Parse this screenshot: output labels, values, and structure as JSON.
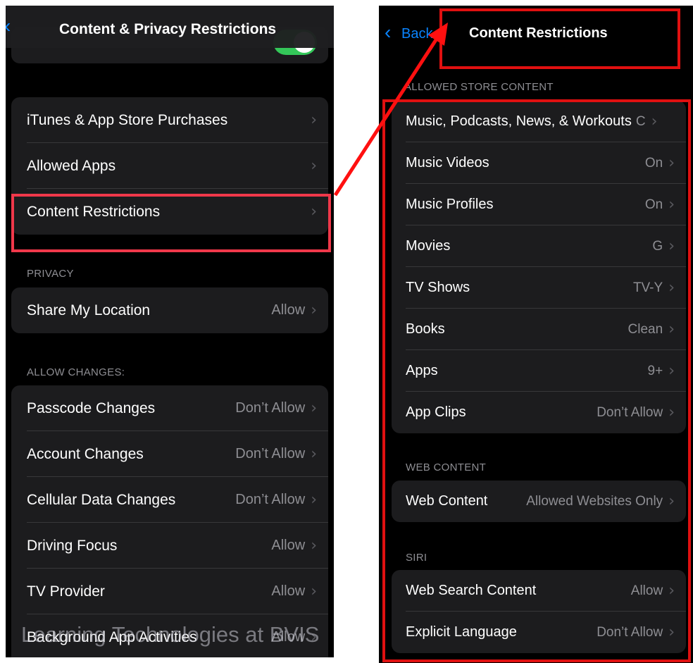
{
  "left_screen": {
    "title": "Content & Privacy Restrictions",
    "main_group": [
      {
        "label": "iTunes & App Store Purchases",
        "value": ""
      },
      {
        "label": "Allowed Apps",
        "value": ""
      },
      {
        "label": "Content Restrictions",
        "value": ""
      }
    ],
    "privacy_header": "PRIVACY",
    "privacy_group": [
      {
        "label": "Share My Location",
        "value": "Allow"
      }
    ],
    "allow_changes_header": "ALLOW CHANGES:",
    "changes_group": [
      {
        "label": "Passcode Changes",
        "value": "Don’t Allow"
      },
      {
        "label": "Account Changes",
        "value": "Don’t Allow"
      },
      {
        "label": "Cellular Data Changes",
        "value": "Don’t Allow"
      },
      {
        "label": "Driving Focus",
        "value": "Allow"
      },
      {
        "label": "TV Provider",
        "value": "Allow"
      },
      {
        "label": "Background App Activities",
        "value": "Allow"
      }
    ]
  },
  "right_screen": {
    "back_label": "Back",
    "title": "Content Restrictions",
    "store_header": "ALLOWED STORE CONTENT",
    "store_group": [
      {
        "label": "Music, Podcasts, News, & Workouts",
        "value": "C"
      },
      {
        "label": "Music Videos",
        "value": "On"
      },
      {
        "label": "Music Profiles",
        "value": "On"
      },
      {
        "label": "Movies",
        "value": "G"
      },
      {
        "label": "TV Shows",
        "value": "TV-Y"
      },
      {
        "label": "Books",
        "value": "Clean"
      },
      {
        "label": "Apps",
        "value": "9+"
      },
      {
        "label": "App Clips",
        "value": "Don’t Allow"
      }
    ],
    "web_header": "WEB CONTENT",
    "web_group": [
      {
        "label": "Web Content",
        "value": "Allowed Websites Only"
      }
    ],
    "siri_header": "SIRI",
    "siri_group": [
      {
        "label": "Web Search Content",
        "value": "Allow"
      },
      {
        "label": "Explicit Language",
        "value": "Don’t Allow"
      }
    ]
  },
  "watermark": "Learning Technologies at BVIS",
  "colors": {
    "background": "#000000",
    "cell": "#1c1c1e",
    "accent": "#0a84ff",
    "toggle_on": "#34c759",
    "highlight": "#e53935"
  }
}
